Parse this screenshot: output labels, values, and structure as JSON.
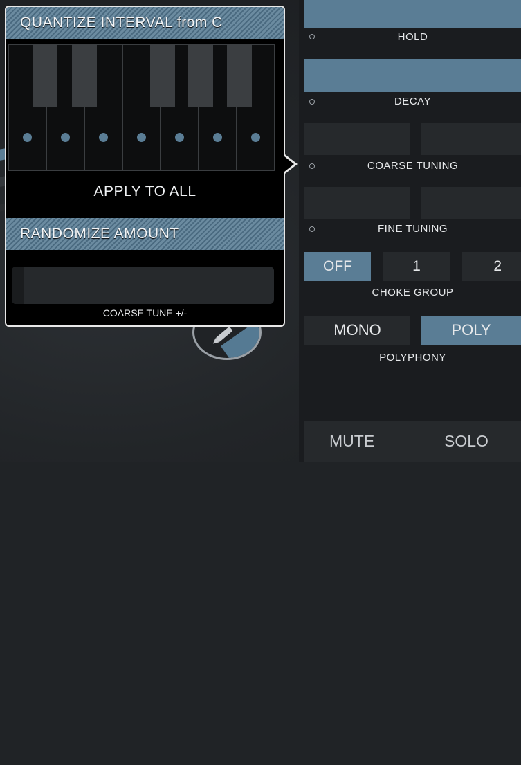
{
  "popover": {
    "quantize_title": "QUANTIZE INTERVAL from C",
    "apply_label": "APPLY TO ALL",
    "randomize_title": "RANDOMIZE AMOUNT",
    "randomize_param": "COARSE TUNE +/-"
  },
  "params": {
    "hold": "HOLD",
    "decay": "DECAY",
    "coarse": "COARSE TUNING",
    "fine": "FINE TUNING"
  },
  "choke": {
    "label": "CHOKE GROUP",
    "options": [
      "OFF",
      "1",
      "2"
    ],
    "selected": "OFF"
  },
  "polyphony": {
    "label": "POLYPHONY",
    "options": [
      "MONO",
      "POLY"
    ],
    "selected": "POLY"
  },
  "mute_solo": {
    "mute": "MUTE",
    "solo": "SOLO"
  },
  "colors": {
    "accent": "#5a7d95",
    "panel": "#1a1c1f",
    "popover_border": "#e8e8e8"
  }
}
